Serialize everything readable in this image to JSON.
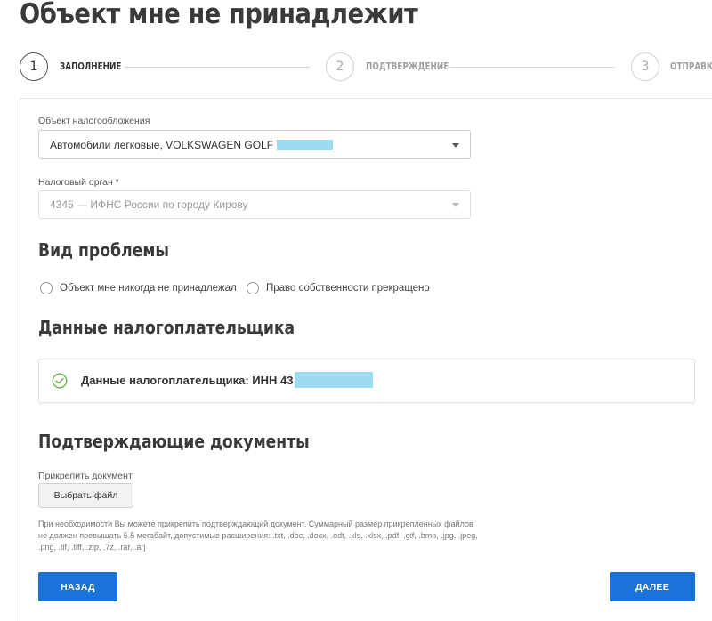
{
  "page": {
    "title": "Объект мне не принадлежит"
  },
  "stepper": {
    "steps": [
      {
        "number": "1",
        "label": "ЗАПОЛНЕНИЕ"
      },
      {
        "number": "2",
        "label": "ПОДТВЕРЖДЕНИЕ"
      },
      {
        "number": "3",
        "label": "ОТПРАВКА"
      }
    ],
    "active_step": 1
  },
  "form": {
    "tax_object": {
      "label": "Объект налогообложения",
      "value": "Автомобили легковые, VOLKSWAGEN GOLF"
    },
    "tax_authority": {
      "label": "Налоговый орган *",
      "value": "4345 — ИФНС России по городу Кирову"
    },
    "problem": {
      "title": "Вид проблемы",
      "options": [
        "Объект мне никогда не принадлежал",
        "Право собственности прекращено"
      ]
    },
    "taxpayer": {
      "title": "Данные налогоплательщика",
      "text": "Данные налогоплательщика: ИНН 43"
    },
    "documents": {
      "title": "Подтверждающие документы",
      "attach_label": "Прикрепить документ",
      "choose_file": "Выбрать файл",
      "hint": "При необходимости Вы можете прикрепить подтверждающий документ. Суммарный размер прикрепленных файлов не должен превышать 5.5 мегабайт, допустимые расширения: .txt, .doc, .docx, .odt, .xls, .xlsx, .pdf, .gif, .bmp, .jpg, .jpeg, .png, .tif, .tiff, .zip, .7z, .rar, .arj"
    }
  },
  "actions": {
    "back": "НАЗАД",
    "next": "ДАЛЕЕ"
  },
  "colors": {
    "primary": "#1a73d9",
    "redaction": "#9ddcf0",
    "success": "#6ab04c"
  },
  "icons": {
    "taxpayer_status": "check-circle-icon",
    "select_arrow": "caret-down-icon"
  }
}
